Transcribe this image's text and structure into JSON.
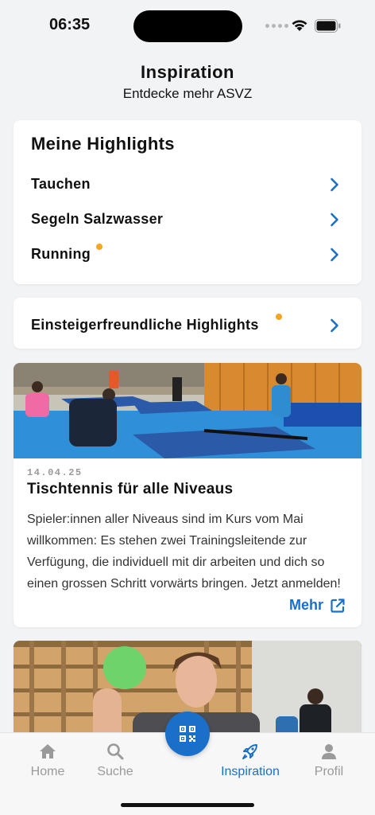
{
  "status_bar": {
    "time": "06:35"
  },
  "header": {
    "title": "Inspiration",
    "subtitle": "Entdecke mehr ASVZ"
  },
  "highlights": {
    "title": "Meine Highlights",
    "items": [
      {
        "label": "Tauchen",
        "badge": false
      },
      {
        "label": "Segeln Salzwasser",
        "badge": false
      },
      {
        "label": "Running",
        "badge": true
      }
    ]
  },
  "beginner": {
    "label": "Einsteigerfreundliche Highlights",
    "badge": true
  },
  "news": {
    "date": "14.04.25",
    "title": "Tischtennis für alle Niveaus",
    "body": "Spieler:innen aller Niveaus sind im Kurs vom Mai willkommen: Es stehen zwei Trainingsleitende zur Verfügung, die individuell mit dir arbeiten und dich so einen grossen Schritt vorwärts bringen. Jetzt anmelden!",
    "more_label": "Mehr"
  },
  "tabs": [
    {
      "label": "Home",
      "icon": "home-icon",
      "active": false
    },
    {
      "label": "Suche",
      "icon": "search-icon",
      "active": false
    },
    {
      "label": "Inspiration",
      "icon": "rocket-icon",
      "active": true
    },
    {
      "label": "Profil",
      "icon": "profile-icon",
      "active": false
    }
  ],
  "colors": {
    "accent": "#1a6fc9",
    "badge": "#f5a623",
    "background": "#f2f3f5"
  }
}
